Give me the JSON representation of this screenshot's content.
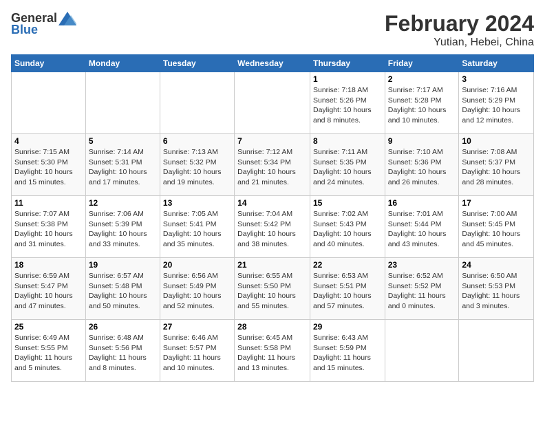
{
  "header": {
    "logo_general": "General",
    "logo_blue": "Blue",
    "month_title": "February 2024",
    "location": "Yutian, Hebei, China"
  },
  "days_of_week": [
    "Sunday",
    "Monday",
    "Tuesday",
    "Wednesday",
    "Thursday",
    "Friday",
    "Saturday"
  ],
  "weeks": [
    [
      {
        "day": "",
        "info": ""
      },
      {
        "day": "",
        "info": ""
      },
      {
        "day": "",
        "info": ""
      },
      {
        "day": "",
        "info": ""
      },
      {
        "day": "1",
        "info": "Sunrise: 7:18 AM\nSunset: 5:26 PM\nDaylight: 10 hours\nand 8 minutes."
      },
      {
        "day": "2",
        "info": "Sunrise: 7:17 AM\nSunset: 5:28 PM\nDaylight: 10 hours\nand 10 minutes."
      },
      {
        "day": "3",
        "info": "Sunrise: 7:16 AM\nSunset: 5:29 PM\nDaylight: 10 hours\nand 12 minutes."
      }
    ],
    [
      {
        "day": "4",
        "info": "Sunrise: 7:15 AM\nSunset: 5:30 PM\nDaylight: 10 hours\nand 15 minutes."
      },
      {
        "day": "5",
        "info": "Sunrise: 7:14 AM\nSunset: 5:31 PM\nDaylight: 10 hours\nand 17 minutes."
      },
      {
        "day": "6",
        "info": "Sunrise: 7:13 AM\nSunset: 5:32 PM\nDaylight: 10 hours\nand 19 minutes."
      },
      {
        "day": "7",
        "info": "Sunrise: 7:12 AM\nSunset: 5:34 PM\nDaylight: 10 hours\nand 21 minutes."
      },
      {
        "day": "8",
        "info": "Sunrise: 7:11 AM\nSunset: 5:35 PM\nDaylight: 10 hours\nand 24 minutes."
      },
      {
        "day": "9",
        "info": "Sunrise: 7:10 AM\nSunset: 5:36 PM\nDaylight: 10 hours\nand 26 minutes."
      },
      {
        "day": "10",
        "info": "Sunrise: 7:08 AM\nSunset: 5:37 PM\nDaylight: 10 hours\nand 28 minutes."
      }
    ],
    [
      {
        "day": "11",
        "info": "Sunrise: 7:07 AM\nSunset: 5:38 PM\nDaylight: 10 hours\nand 31 minutes."
      },
      {
        "day": "12",
        "info": "Sunrise: 7:06 AM\nSunset: 5:39 PM\nDaylight: 10 hours\nand 33 minutes."
      },
      {
        "day": "13",
        "info": "Sunrise: 7:05 AM\nSunset: 5:41 PM\nDaylight: 10 hours\nand 35 minutes."
      },
      {
        "day": "14",
        "info": "Sunrise: 7:04 AM\nSunset: 5:42 PM\nDaylight: 10 hours\nand 38 minutes."
      },
      {
        "day": "15",
        "info": "Sunrise: 7:02 AM\nSunset: 5:43 PM\nDaylight: 10 hours\nand 40 minutes."
      },
      {
        "day": "16",
        "info": "Sunrise: 7:01 AM\nSunset: 5:44 PM\nDaylight: 10 hours\nand 43 minutes."
      },
      {
        "day": "17",
        "info": "Sunrise: 7:00 AM\nSunset: 5:45 PM\nDaylight: 10 hours\nand 45 minutes."
      }
    ],
    [
      {
        "day": "18",
        "info": "Sunrise: 6:59 AM\nSunset: 5:47 PM\nDaylight: 10 hours\nand 47 minutes."
      },
      {
        "day": "19",
        "info": "Sunrise: 6:57 AM\nSunset: 5:48 PM\nDaylight: 10 hours\nand 50 minutes."
      },
      {
        "day": "20",
        "info": "Sunrise: 6:56 AM\nSunset: 5:49 PM\nDaylight: 10 hours\nand 52 minutes."
      },
      {
        "day": "21",
        "info": "Sunrise: 6:55 AM\nSunset: 5:50 PM\nDaylight: 10 hours\nand 55 minutes."
      },
      {
        "day": "22",
        "info": "Sunrise: 6:53 AM\nSunset: 5:51 PM\nDaylight: 10 hours\nand 57 minutes."
      },
      {
        "day": "23",
        "info": "Sunrise: 6:52 AM\nSunset: 5:52 PM\nDaylight: 11 hours\nand 0 minutes."
      },
      {
        "day": "24",
        "info": "Sunrise: 6:50 AM\nSunset: 5:53 PM\nDaylight: 11 hours\nand 3 minutes."
      }
    ],
    [
      {
        "day": "25",
        "info": "Sunrise: 6:49 AM\nSunset: 5:55 PM\nDaylight: 11 hours\nand 5 minutes."
      },
      {
        "day": "26",
        "info": "Sunrise: 6:48 AM\nSunset: 5:56 PM\nDaylight: 11 hours\nand 8 minutes."
      },
      {
        "day": "27",
        "info": "Sunrise: 6:46 AM\nSunset: 5:57 PM\nDaylight: 11 hours\nand 10 minutes."
      },
      {
        "day": "28",
        "info": "Sunrise: 6:45 AM\nSunset: 5:58 PM\nDaylight: 11 hours\nand 13 minutes."
      },
      {
        "day": "29",
        "info": "Sunrise: 6:43 AM\nSunset: 5:59 PM\nDaylight: 11 hours\nand 15 minutes."
      },
      {
        "day": "",
        "info": ""
      },
      {
        "day": "",
        "info": ""
      }
    ]
  ]
}
